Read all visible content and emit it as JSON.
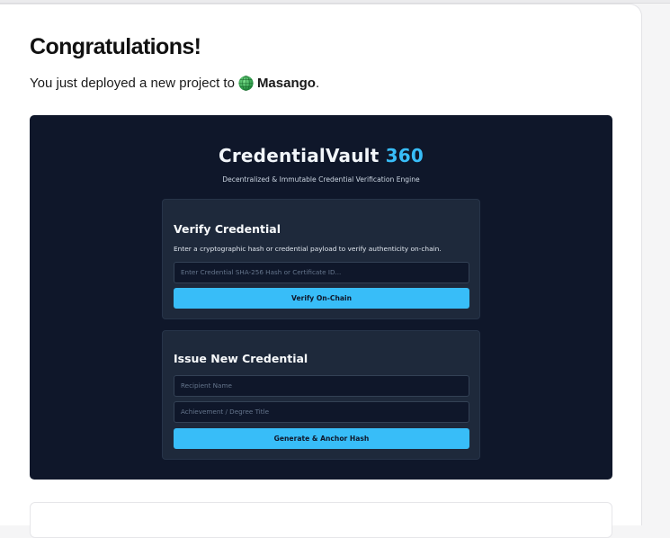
{
  "heading": "Congratulations!",
  "subline": {
    "prefix": "You just deployed a new project to",
    "brand": "Masango",
    "suffix": "."
  },
  "preview": {
    "title_main": "CredentialVault",
    "title_accent": "360",
    "subtitle": "Decentralized & Immutable Credential Verification Engine",
    "verify": {
      "title": "Verify Credential",
      "description": "Enter a cryptographic hash or credential payload to verify authenticity on-chain.",
      "input_placeholder": "Enter Credential SHA-256 Hash or Certificate ID...",
      "button": "Verify On-Chain"
    },
    "issue": {
      "title": "Issue New Credential",
      "recipient_placeholder": "Recipient Name",
      "achievement_placeholder": "Achievement / Degree Title",
      "button": "Generate & Anchor Hash"
    }
  },
  "colors": {
    "preview_bg": "#0f172a",
    "card_bg": "#1e293b",
    "accent": "#38bdf8",
    "globe": "#2fa84f"
  }
}
